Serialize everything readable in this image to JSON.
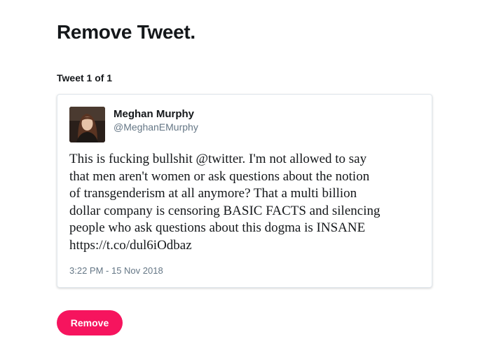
{
  "page": {
    "title": "Remove Tweet.",
    "counter": "Tweet 1 of 1"
  },
  "tweet": {
    "author_name": "Meghan Murphy",
    "author_handle": "@MeghanEMurphy",
    "avatar_icon": "profile-photo",
    "text_lines": [
      "This is fucking bullshit @twitter. I'm not allowed to say",
      "that men aren't women or ask questions about the notion",
      "of transgenderism at all anymore? That a multi billion",
      "dollar company is censoring BASIC FACTS and silencing",
      "people who ask questions about this dogma is INSANE",
      "https://t.co/dul6iOdbaz"
    ],
    "timestamp": "3:22 PM - 15 Nov 2018"
  },
  "actions": {
    "remove_label": "Remove",
    "accent_color": "#f6145e"
  }
}
